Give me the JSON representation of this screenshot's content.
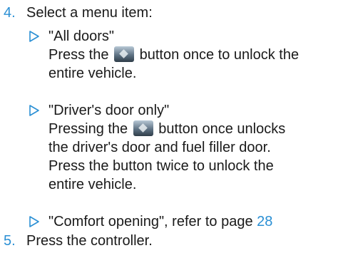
{
  "steps": [
    {
      "number": "4.",
      "text": "Select a menu item:"
    },
    {
      "number": "5.",
      "text": "Press the controller."
    }
  ],
  "options": [
    {
      "title": "\"All doors\"",
      "desc_before_icon": "Press the",
      "desc_after_icon": "button once to unlock the",
      "desc_lines": [
        "entire vehicle."
      ]
    },
    {
      "title": "\"Driver's door only\"",
      "desc_before_icon": "Pressing the",
      "desc_after_icon": "button once unlocks",
      "desc_lines": [
        "the driver's door and fuel filler door.",
        "Press the button twice to unlock the",
        "entire vehicle."
      ]
    },
    {
      "title": "\"Comfort opening\", refer to page",
      "page_ref": "28"
    }
  ],
  "icons": {
    "bullet": "triangle-outline-icon",
    "unlock_button": "unlock-button-icon"
  },
  "colors": {
    "accent": "#2a8fd4",
    "text": "#1a1a1a"
  }
}
